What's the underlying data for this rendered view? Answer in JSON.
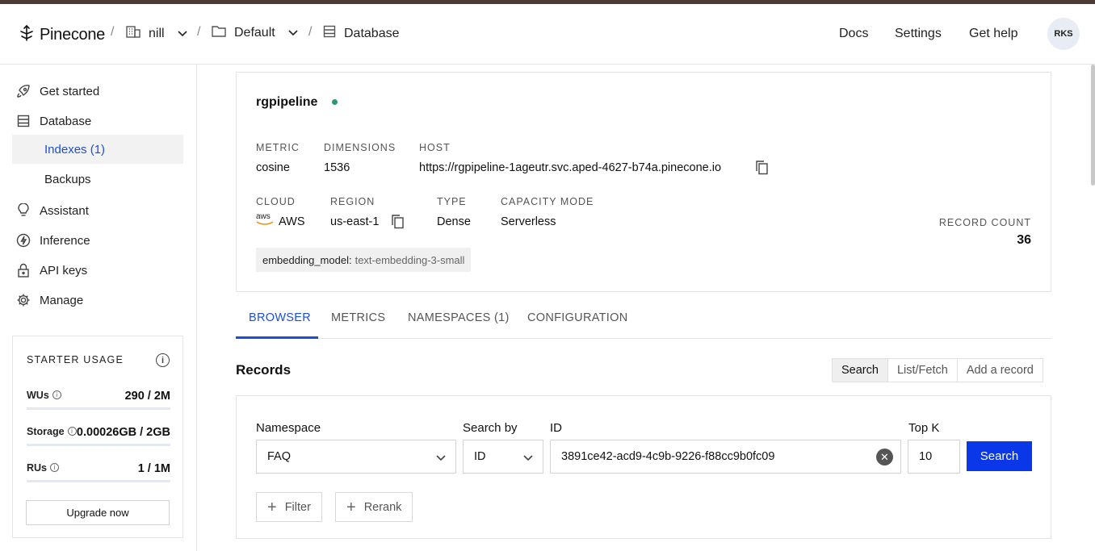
{
  "header": {
    "logo_text": "Pinecone",
    "project": "nill",
    "environment": "Default",
    "section": "Database",
    "nav": [
      "Docs",
      "Settings",
      "Get help"
    ],
    "avatar_initials": "RKS"
  },
  "sidebar": {
    "items": [
      {
        "label": "Get started",
        "icon": "rocket-icon"
      },
      {
        "label": "Database",
        "icon": "database-icon"
      },
      {
        "label": "Indexes (1)",
        "icon": ""
      },
      {
        "label": "Backups",
        "icon": ""
      },
      {
        "label": "Assistant",
        "icon": "lightbulb-icon"
      },
      {
        "label": "Inference",
        "icon": "bolt-icon"
      },
      {
        "label": "API keys",
        "icon": "lock-icon"
      },
      {
        "label": "Manage",
        "icon": "gear-icon"
      }
    ],
    "usage": {
      "title": "STARTER USAGE",
      "rows": [
        {
          "label": "WUs",
          "value": "290 / 2M",
          "fraction": 0.000145
        },
        {
          "label": "Storage",
          "value": "0.00026GB / 2GB",
          "fraction": 0.00013
        },
        {
          "label": "RUs",
          "value": "1 / 1M",
          "fraction": 1e-06
        }
      ],
      "upgrade_label": "Upgrade now"
    }
  },
  "index": {
    "name": "rgpipeline",
    "status_color": "#22a06b",
    "metric_label": "METRIC",
    "metric": "cosine",
    "dimensions_label": "DIMENSIONS",
    "dimensions": "1536",
    "host_label": "HOST",
    "host": "https://rgpipeline-1ageutr.svc.aped-4627-b74a.pinecone.io",
    "cloud_label": "CLOUD",
    "cloud_logo": "aws",
    "cloud": "AWS",
    "region_label": "REGION",
    "region": "us-east-1",
    "type_label": "TYPE",
    "type": "Dense",
    "capacity_label": "CAPACITY MODE",
    "capacity": "Serverless",
    "record_count_label": "RECORD COUNT",
    "record_count": "36",
    "tag_key": "embedding_model:",
    "tag_value": "text-embedding-3-small"
  },
  "tabs": [
    "BROWSER",
    "METRICS",
    "NAMESPACES (1)",
    "CONFIGURATION"
  ],
  "records": {
    "title": "Records",
    "modes": [
      "Search",
      "List/Fetch",
      "Add a record"
    ],
    "namespace_label": "Namespace",
    "namespace_value": "FAQ",
    "search_by_label": "Search by",
    "search_by_value": "ID",
    "id_label": "ID",
    "id_value": "3891ce42-acd9-4c9b-9226-f88cc9b0fc09",
    "topk_label": "Top K",
    "topk_value": "10",
    "search_button": "Search",
    "filter_button": "Filter",
    "rerank_button": "Rerank"
  },
  "colors": {
    "accent": "#1d4ed8",
    "primary_button": "#0a37e8"
  }
}
